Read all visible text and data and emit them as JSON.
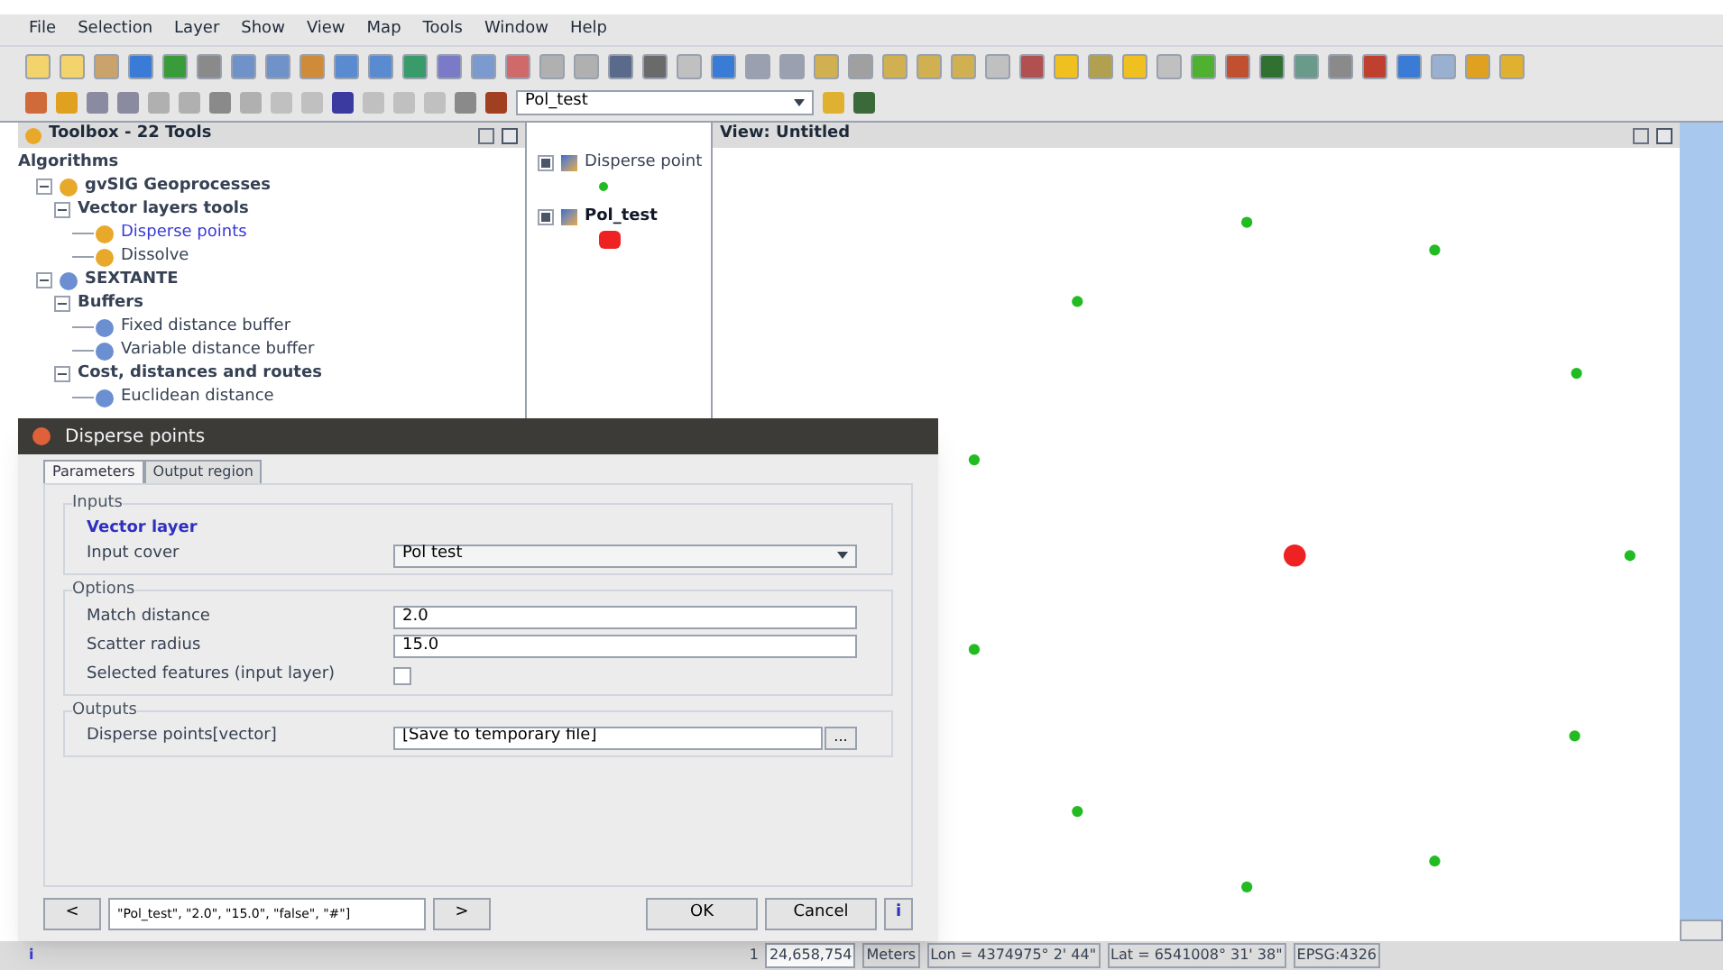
{
  "menu_bar": [
    "File",
    "Selection",
    "Layer",
    "Show",
    "View",
    "Map",
    "Tools",
    "Window",
    "Help"
  ],
  "toolbar": {
    "layer_combo": {
      "value": "Pol_test"
    }
  },
  "toolbox": {
    "title": "Toolbox - 22 Tools",
    "tree": [
      {
        "label": "Algorithms",
        "selected": false,
        "children": [
          {
            "label": "gvSIG Geoprocesses",
            "kind": "gvsig",
            "expanded": true,
            "selected": false,
            "children": [
              {
                "label": "Vector layers tools",
                "expanded": true,
                "selected": false,
                "children": [
                  {
                    "label": "Disperse points",
                    "kind": "gvsig",
                    "selected": true
                  },
                  {
                    "label": "Dissolve",
                    "kind": "gvsig",
                    "selected": false
                  }
                ]
              }
            ]
          },
          {
            "label": "SEXTANTE",
            "kind": "sextante",
            "expanded": true,
            "selected": false,
            "children": [
              {
                "label": "Buffers",
                "expanded": true,
                "selected": false,
                "children": [
                  {
                    "label": "Fixed distance buffer",
                    "kind": "sextante",
                    "selected": false
                  },
                  {
                    "label": "Variable distance buffer",
                    "kind": "sextante",
                    "selected": false
                  }
                ]
              },
              {
                "label": "Cost, distances and routes",
                "expanded": true,
                "selected": false,
                "children": [
                  {
                    "label": "Euclidean distance",
                    "kind": "sextante",
                    "selected": false
                  }
                ]
              }
            ]
          }
        ]
      }
    ]
  },
  "legend": {
    "layers": [
      {
        "name": "Disperse point",
        "checked": true,
        "selected": false,
        "color": "#22bb22",
        "kind": "point"
      },
      {
        "name": "Pol_test",
        "checked": true,
        "selected": true,
        "color": "#ee2222",
        "kind": "polygon"
      }
    ]
  },
  "view": {
    "title": "View: Untitled"
  },
  "dialog": {
    "title": "Disperse points",
    "tabs": [
      {
        "label": "Parameters",
        "selected": true
      },
      {
        "label": "Output region",
        "selected": false
      }
    ],
    "groups": [
      {
        "title": "Inputs",
        "subtitle": "Vector layer",
        "rows": [
          {
            "kind": "select",
            "label": "Input cover",
            "value": "Pol test"
          }
        ]
      },
      {
        "title": "Options",
        "rows": [
          {
            "kind": "text",
            "label": "Match distance",
            "value": "2.0"
          },
          {
            "kind": "text",
            "label": "Scatter radius",
            "value": "15.0"
          },
          {
            "kind": "checkbox",
            "label": "Selected features (input layer)",
            "checked": false
          }
        ]
      },
      {
        "title": "Outputs",
        "rows": [
          {
            "kind": "output",
            "label": "Disperse points[vector]",
            "value": "[Save to temporary file]",
            "browse": "..."
          }
        ]
      }
    ],
    "history": {
      "prev": "<",
      "command": "\"Pol_test\", \"2.0\", \"15.0\", \"false\", \"#\"]",
      "next": ">"
    },
    "buttons": [
      "OK",
      "Cancel"
    ],
    "info": "i"
  },
  "status_bar": {
    "info": "i",
    "scale_prefix": "1",
    "scale": "24,658,754",
    "units": "Meters",
    "lon": "Lon = 4374975° 2' 44\"",
    "lat": "Lat = 6541008° 31' 38\"",
    "crs": "EPSG:4326"
  }
}
